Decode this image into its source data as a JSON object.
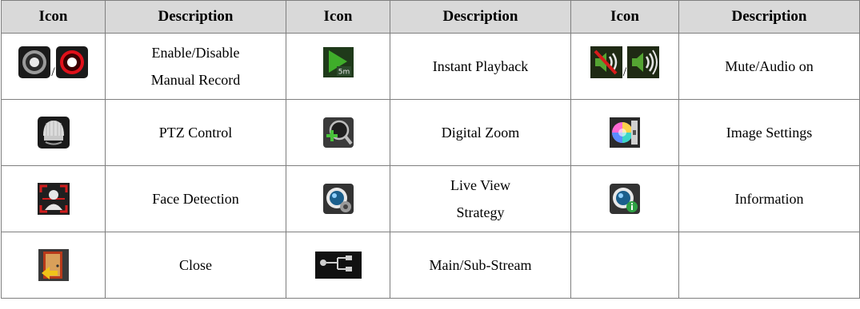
{
  "header": {
    "col_icon": "Icon",
    "col_desc": "Description"
  },
  "rows": [
    [
      {
        "icon": [
          "record-off-icon",
          "record-on-icon"
        ],
        "separator": "/",
        "desc": "Enable/Disable Manual Record"
      },
      {
        "icon": [
          "instant-playback-icon"
        ],
        "desc": "Instant Playback"
      },
      {
        "icon": [
          "mute-icon",
          "audio-on-icon"
        ],
        "separator": "/",
        "desc": "Mute/Audio on"
      }
    ],
    [
      {
        "icon": [
          "ptz-dome-icon"
        ],
        "desc": "PTZ Control"
      },
      {
        "icon": [
          "digital-zoom-icon"
        ],
        "desc": "Digital Zoom"
      },
      {
        "icon": [
          "image-settings-icon"
        ],
        "desc": "Image Settings"
      }
    ],
    [
      {
        "icon": [
          "face-detection-icon"
        ],
        "desc": "Face Detection"
      },
      {
        "icon": [
          "live-view-strategy-icon"
        ],
        "desc": "Live View Strategy"
      },
      {
        "icon": [
          "information-icon"
        ],
        "desc": "Information"
      }
    ],
    [
      {
        "icon": [
          "close-door-icon"
        ],
        "desc": "Close"
      },
      {
        "icon": [
          "main-sub-stream-icon"
        ],
        "desc": "Main/Sub-Stream"
      },
      {
        "icon": [],
        "desc": ""
      }
    ]
  ],
  "cells": {
    "r1c1_sep": "/",
    "r1c1_desc_line1": "Enable/Disable",
    "r1c1_desc_line2": "Manual Record",
    "r1c2_desc": "Instant Playback",
    "r1c2_badge": "5m",
    "r1c3_sep": "/",
    "r1c3_desc": "Mute/Audio on",
    "r2c1_desc": "PTZ Control",
    "r2c2_desc": "Digital Zoom",
    "r2c3_desc": "Image Settings",
    "r3c1_desc": "Face Detection",
    "r3c2_desc_line1": "Live View",
    "r3c2_desc_line2": "Strategy",
    "r3c3_desc": "Information",
    "r4c1_desc": "Close",
    "r4c2_desc": "Main/Sub-Stream"
  },
  "colors": {
    "header_bg": "#d9d9d9",
    "border": "#7f7f7f",
    "record_red": "#e0101a",
    "playback_green": "#3fae2a"
  }
}
